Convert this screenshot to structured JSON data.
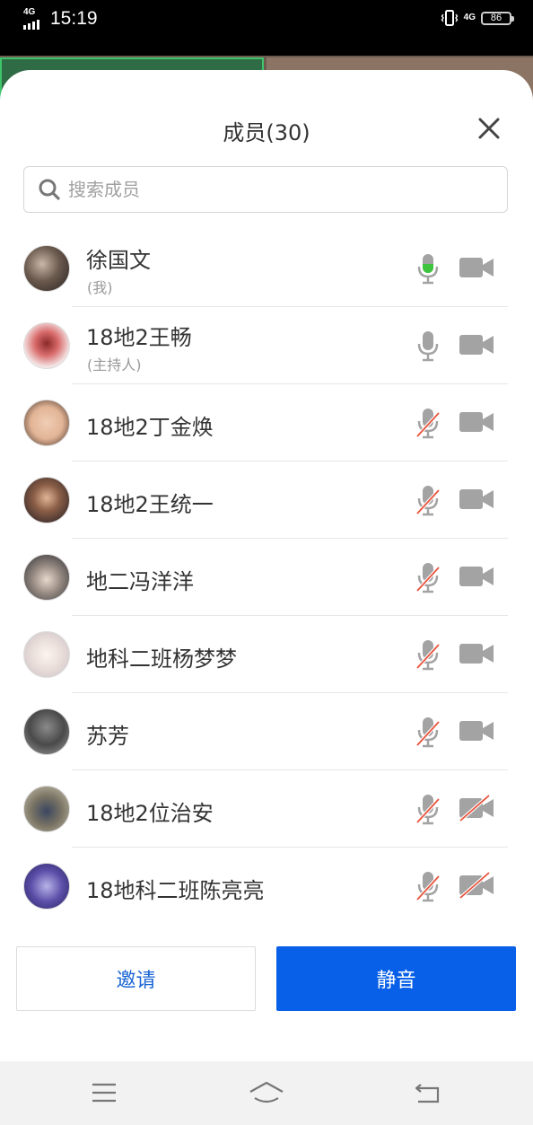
{
  "status_bar": {
    "network_left": "4G",
    "time": "15:19",
    "network_right": "4G",
    "battery": "86"
  },
  "panel": {
    "title": "成员(30)",
    "search_placeholder": "搜索成员"
  },
  "members": [
    {
      "name": "徐国文",
      "role": "(我)",
      "mic": "speaking",
      "camera": "on"
    },
    {
      "name": "18地2王畅",
      "role": "(主持人)",
      "mic": "on",
      "camera": "on"
    },
    {
      "name": "18地2丁金焕",
      "role": "",
      "mic": "muted",
      "camera": "on"
    },
    {
      "name": "18地2王统一",
      "role": "",
      "mic": "muted",
      "camera": "on"
    },
    {
      "name": "地二冯洋洋",
      "role": "",
      "mic": "muted",
      "camera": "on"
    },
    {
      "name": "地科二班杨梦梦",
      "role": "",
      "mic": "muted",
      "camera": "on"
    },
    {
      "name": "苏芳",
      "role": "",
      "mic": "muted",
      "camera": "on"
    },
    {
      "name": "18地2位治安",
      "role": "",
      "mic": "muted",
      "camera": "off"
    },
    {
      "name": "18地科二班陈亮亮",
      "role": "",
      "mic": "muted",
      "camera": "off"
    }
  ],
  "actions": {
    "invite": "邀请",
    "mute": "静音"
  },
  "colors": {
    "primary": "#0860e8",
    "speaking": "#3ec43e",
    "muted_slash": "#e8533c",
    "icon_gray": "#a3a3a3"
  },
  "icons": {
    "close": "close-icon",
    "search": "search-icon",
    "mic": "mic-icon",
    "camera": "video-camera-icon",
    "nav": [
      "menu-icon",
      "home-icon",
      "back-icon"
    ]
  }
}
